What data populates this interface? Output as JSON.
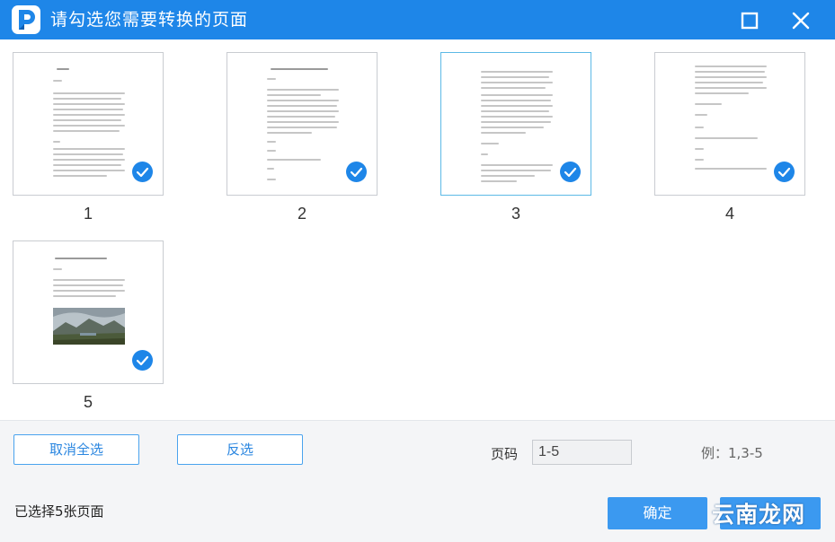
{
  "window": {
    "title": "请勾选您需要转换的页面",
    "logo_icon": "app-logo-p-icon",
    "maximize_icon": "maximize-icon",
    "close_icon": "close-icon",
    "accent": "#1e86e8"
  },
  "pages": [
    {
      "number": "1",
      "selected": true
    },
    {
      "number": "2",
      "selected": true
    },
    {
      "number": "3",
      "selected": true
    },
    {
      "number": "4",
      "selected": true
    },
    {
      "number": "5",
      "selected": true
    }
  ],
  "footer": {
    "cancel_all_label": "取消全选",
    "invert_label": "反选",
    "page_label": "页码",
    "page_value": "1-5",
    "example_hint": "例：1,3-5",
    "selected_count": "已选择5张页面",
    "confirm_label": "确定",
    "watermark": "云南龙网"
  }
}
